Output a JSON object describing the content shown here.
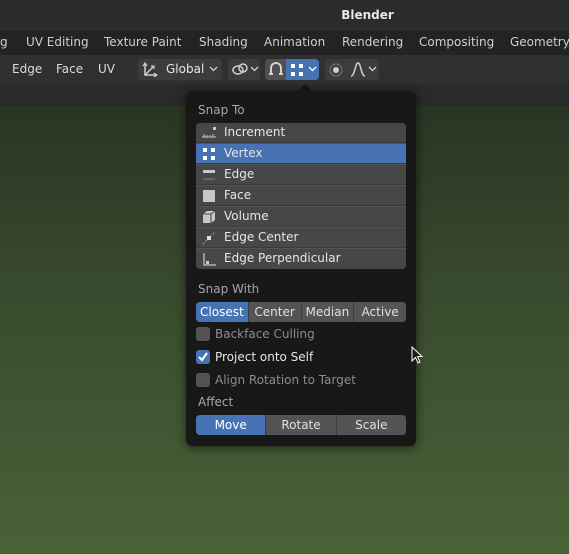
{
  "window": {
    "title": "Blender"
  },
  "workspaces": [
    "g",
    "UV Editing",
    "Texture Paint",
    "Shading",
    "Animation",
    "Rendering",
    "Compositing",
    "Geometry"
  ],
  "header": {
    "menu": [
      "Edge",
      "Face",
      "UV"
    ],
    "transform_orientation": "Global"
  },
  "snap_popup": {
    "snap_to_label": "Snap To",
    "snap_to_items": [
      {
        "label": "Increment",
        "icon": "increment-icon"
      },
      {
        "label": "Vertex",
        "icon": "vertex-icon",
        "selected": true
      },
      {
        "label": "Edge",
        "icon": "edge-icon"
      },
      {
        "label": "Face",
        "icon": "face-icon"
      },
      {
        "label": "Volume",
        "icon": "volume-icon"
      },
      {
        "label": "Edge Center",
        "icon": "edge-center-icon"
      },
      {
        "label": "Edge Perpendicular",
        "icon": "edge-perpendicular-icon"
      }
    ],
    "snap_with_label": "Snap With",
    "snap_with_options": [
      "Closest",
      "Center",
      "Median",
      "Active"
    ],
    "snap_with_selected": "Closest",
    "backface_culling": {
      "label": "Backface Culling",
      "checked": false
    },
    "project_onto_self": {
      "label": "Project onto Self",
      "checked": true
    },
    "align_rotation": {
      "label": "Align Rotation to Target",
      "checked": false
    },
    "affect_label": "Affect",
    "affect_options": [
      "Move",
      "Rotate",
      "Scale"
    ],
    "affect_selected": "Move"
  },
  "colors": {
    "accent": "#4772b3",
    "popup_bg": "#181818",
    "item_bg": "#474747"
  }
}
